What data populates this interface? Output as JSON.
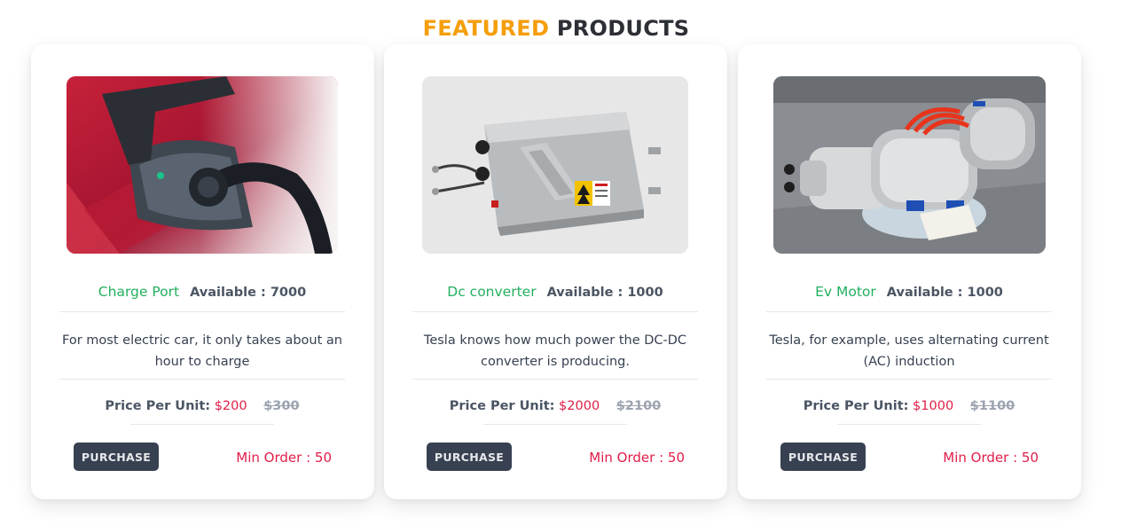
{
  "section": {
    "title_accent": "FEATURED",
    "title_rest": "PRODUCTS"
  },
  "colors": {
    "accent": "#f59e0b",
    "product_name": "#22b060",
    "price": "#e11d48",
    "button": "#374151"
  },
  "products": [
    {
      "name": "Charge Port",
      "availability": "Available : 7000",
      "description": "For most electric car, it only takes about an hour to charge",
      "price_label": "Price Per Unit:",
      "price": "$200",
      "old_price": "$300",
      "button_label": "PURCHASE",
      "min_order": "Min Order : 50"
    },
    {
      "name": "Dc converter",
      "availability": "Available : 1000",
      "description": "Tesla knows how much power the DC-DC converter is producing.",
      "price_label": "Price Per Unit:",
      "price": "$2000",
      "old_price": "$2100",
      "button_label": "PURCHASE",
      "min_order": "Min Order : 50"
    },
    {
      "name": "Ev Motor",
      "availability": "Available : 1000",
      "description": "Tesla, for example, uses alternating current (AC) induction",
      "price_label": "Price Per Unit:",
      "price": "$1000",
      "old_price": "$1100",
      "button_label": "PURCHASE",
      "min_order": "Min Order : 50"
    }
  ]
}
